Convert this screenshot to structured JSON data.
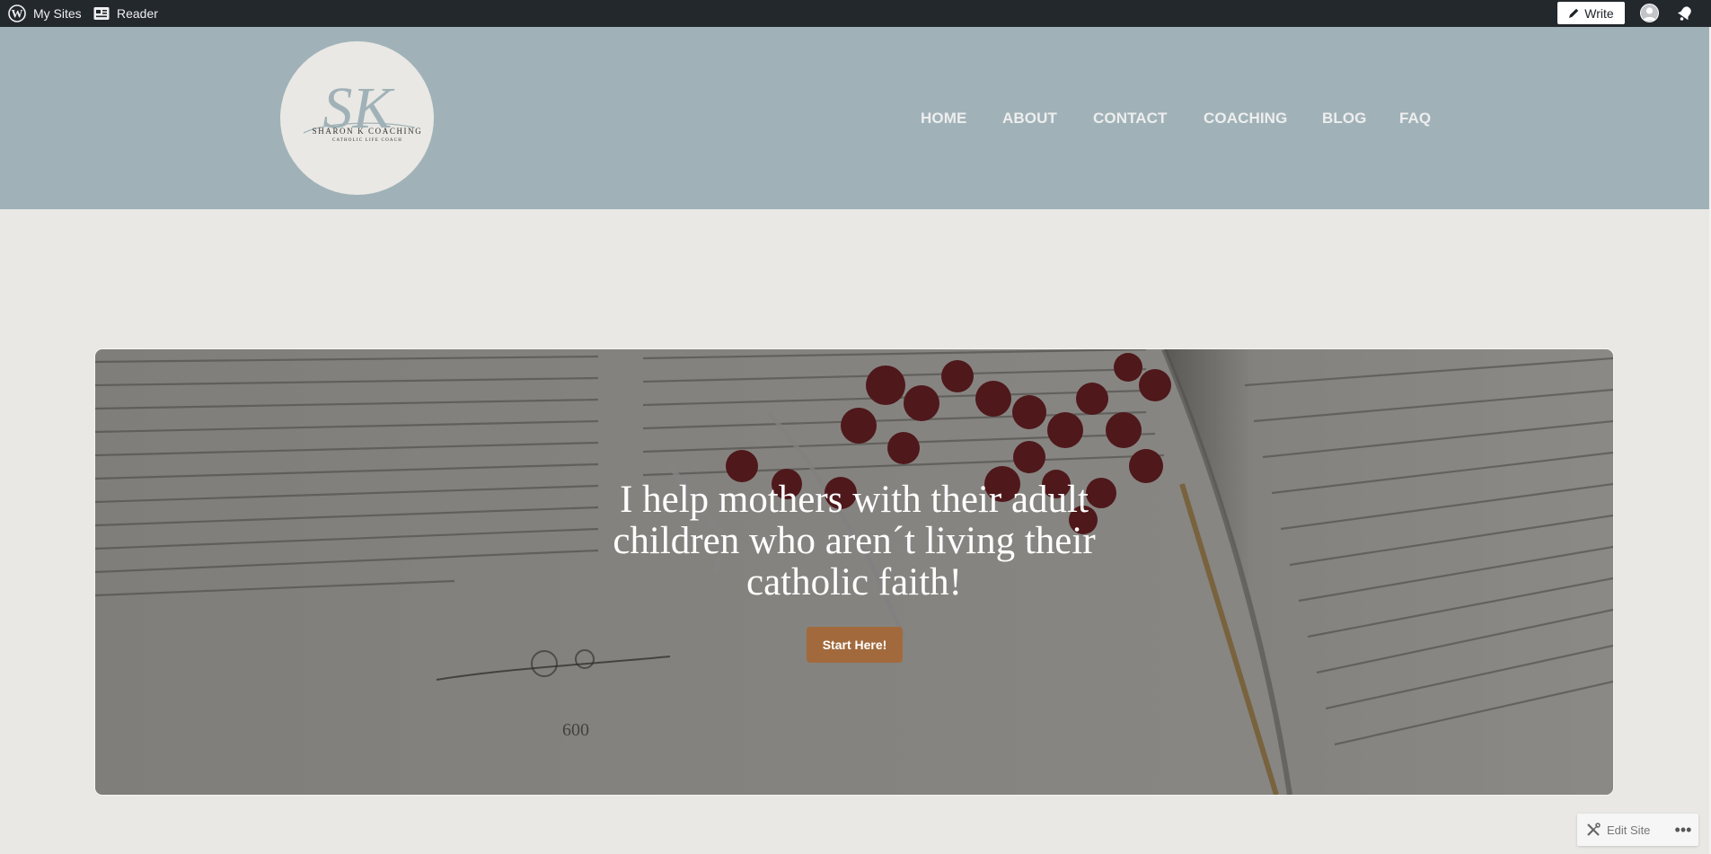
{
  "admin_bar": {
    "my_sites": "My Sites",
    "reader": "Reader",
    "write": "Write"
  },
  "header": {
    "logo": {
      "monogram": "SK",
      "name": "SHARON K COACHING",
      "tagline": "CATHOLIC LIFE COACH"
    },
    "nav": [
      "HOME",
      "ABOUT",
      "CONTACT",
      "COACHING",
      "BLOG",
      "FAQ"
    ]
  },
  "hero": {
    "title": "I help mothers with their adult children who aren´t living their catholic faith!",
    "button": "Start Here!",
    "book_page_number": "600"
  },
  "footer_tools": {
    "edit_site": "Edit Site",
    "more": "•••"
  },
  "colors": {
    "admin_bar": "#23282d",
    "header_bg": "#a0b2b8",
    "page_bg": "#e9e8e4",
    "button_bg": "#a26a3c",
    "rosary_beads": "#7a1d22"
  },
  "icons": {
    "wordpress": "wordpress-icon",
    "reader": "reader-icon",
    "write": "pen-icon",
    "notifications": "bell-icon",
    "edit_site": "tools-icon"
  }
}
